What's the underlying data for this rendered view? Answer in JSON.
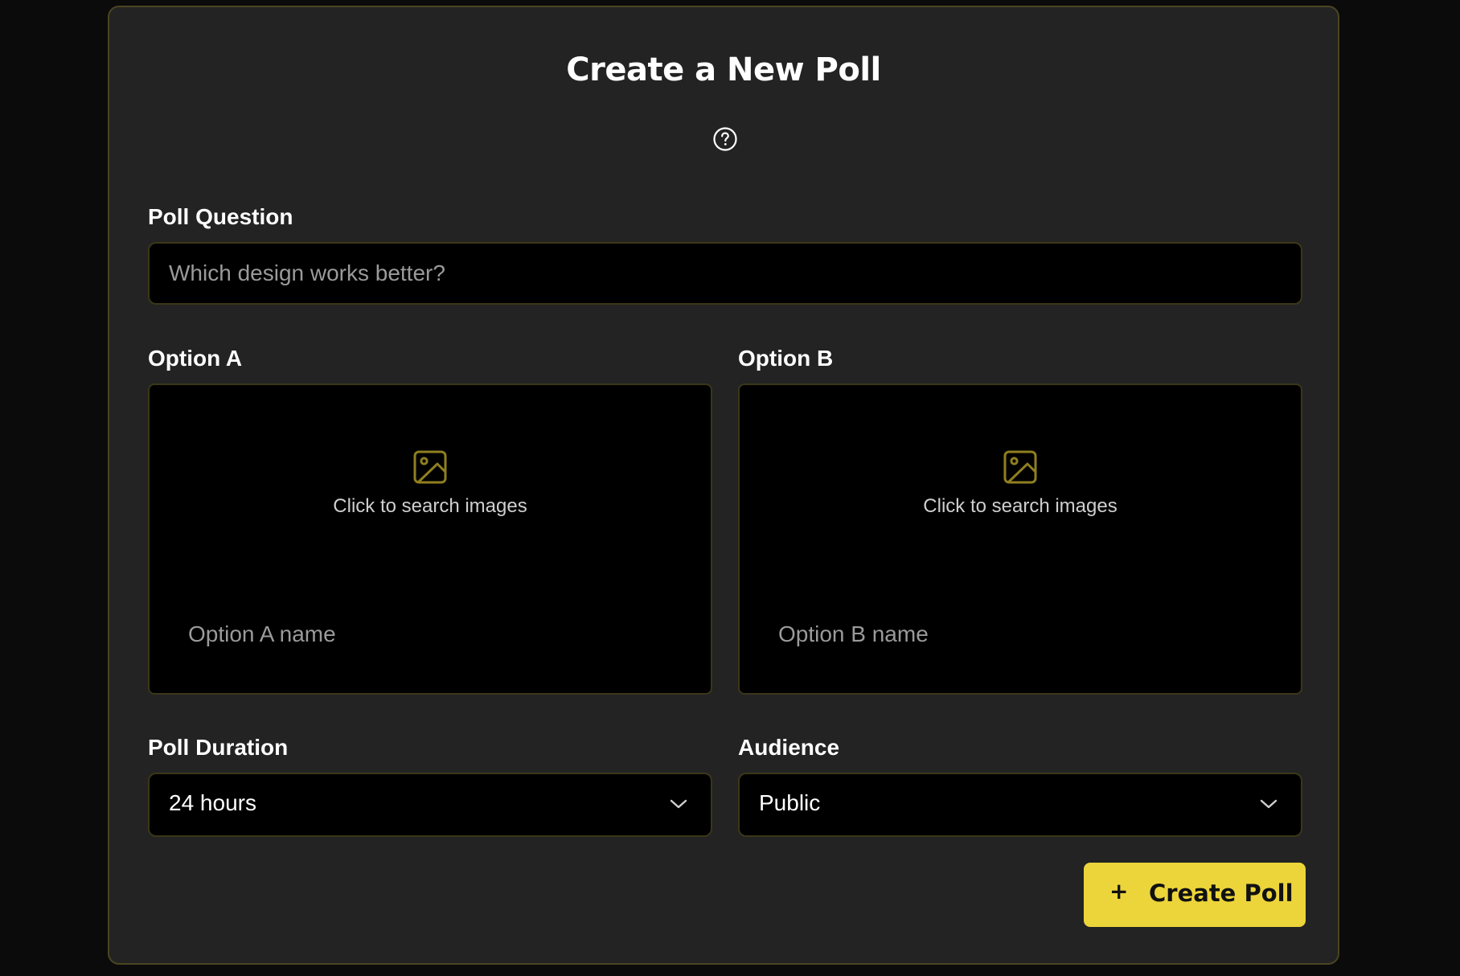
{
  "card": {
    "title": "Create a New Poll",
    "help_icon": "help-circle-icon"
  },
  "question": {
    "label": "Poll Question",
    "value": "",
    "placeholder": "Which design works better?"
  },
  "options": [
    {
      "label": "Option A",
      "image_icon": "image-icon",
      "search_text": "Click to search images",
      "name_value": "",
      "name_placeholder": "Option A name"
    },
    {
      "label": "Option B",
      "image_icon": "image-icon",
      "search_text": "Click to search images",
      "name_value": "",
      "name_placeholder": "Option B name"
    }
  ],
  "duration": {
    "label": "Poll Duration",
    "selected": "24 hours",
    "icon": "chevron-down-icon"
  },
  "audience": {
    "label": "Audience",
    "selected": "Public",
    "icon": "chevron-down-icon"
  },
  "submit": {
    "icon": "+",
    "label": "Create Poll"
  },
  "colors": {
    "page_background": "#0b0b0b",
    "card_background": "#232323",
    "card_border": "#4a4521",
    "field_background": "#000000",
    "field_border": "#3b3718",
    "accent": "#ecd53a",
    "icon_accent": "#8f7f1f",
    "placeholder_text": "#9a9a9a"
  }
}
